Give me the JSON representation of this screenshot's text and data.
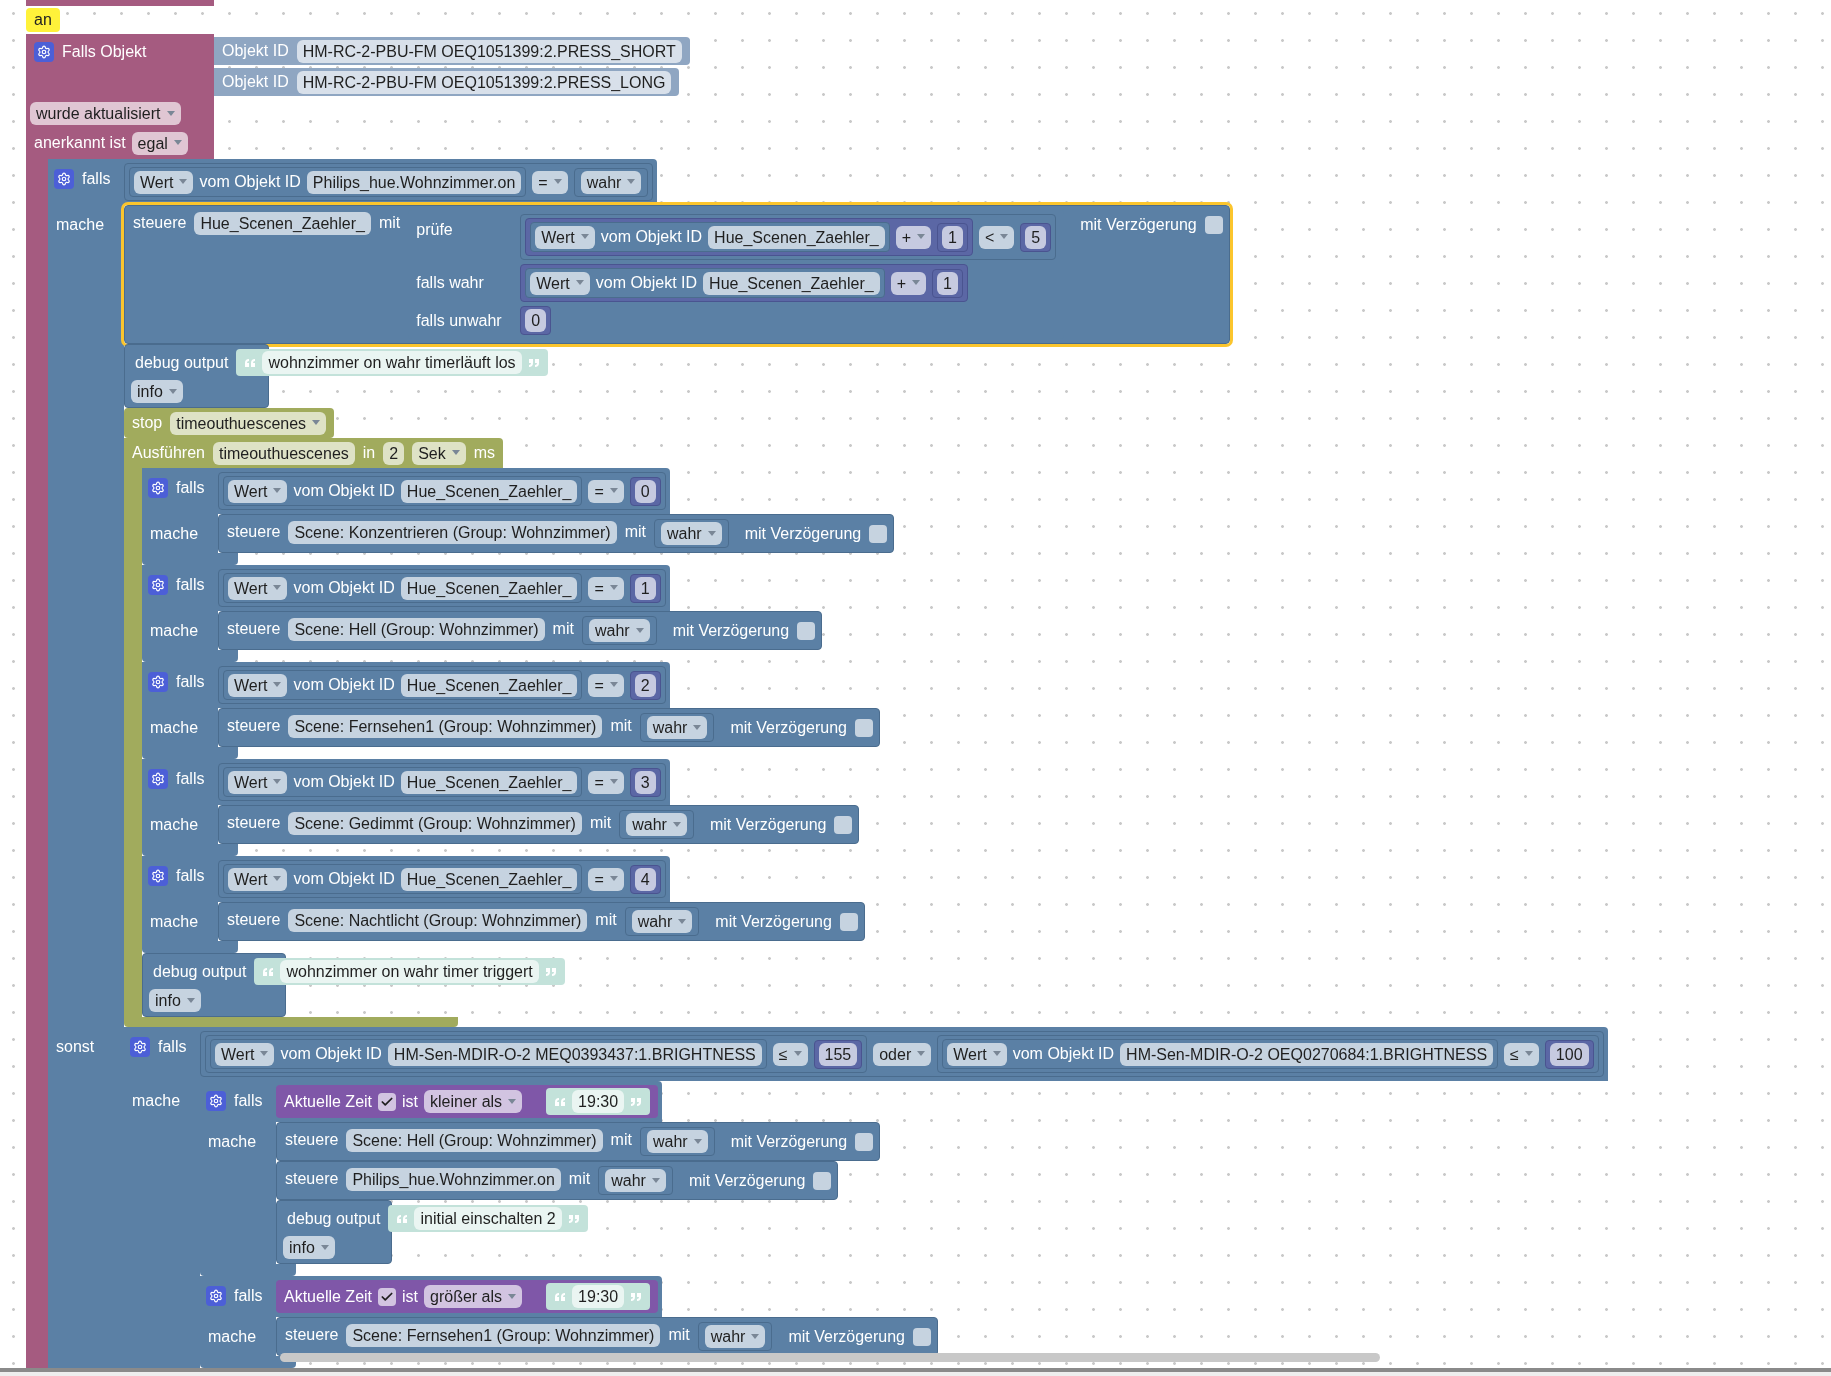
{
  "trigger": {
    "tag": "an",
    "title": "Falls Objekt",
    "objects": [
      {
        "label": "Objekt ID",
        "value": "HM-RC-2-PBU-FM OEQ1051399:2.PRESS_SHORT"
      },
      {
        "label": "Objekt ID",
        "value": "HM-RC-2-PBU-FM OEQ1051399:2.PRESS_LONG"
      }
    ],
    "event": "wurde aktualisiert",
    "ack_label": "anerkannt ist",
    "ack": "egal",
    "body": [
      {
        "kind": "if",
        "selected": false,
        "label": "falls",
        "condition": {
          "kind": "compare",
          "left": {
            "kind": "state",
            "attr": "Wert",
            "label": "vom Objekt ID",
            "id": "Philips_hue.Wohnzimmer.on"
          },
          "op": "=",
          "right": {
            "kind": "choice",
            "value": "wahr"
          }
        },
        "do_label": "mache",
        "do": [
          {
            "kind": "control",
            "selected": true,
            "label": "steuere",
            "target": "Hue_Scenen_Zaehler_",
            "with": "mit",
            "value": {
              "kind": "ternary",
              "test_label": "prüfe",
              "test": {
                "kind": "compare",
                "left": {
                  "kind": "arith",
                  "left": {
                    "kind": "state",
                    "attr": "Wert",
                    "label": "vom Objekt ID",
                    "id": "Hue_Scenen_Zaehler_"
                  },
                  "op": "+",
                  "right": {
                    "kind": "number",
                    "value": "1"
                  }
                },
                "op": "<",
                "right": {
                  "kind": "number",
                  "value": "5"
                }
              },
              "then_label": "falls wahr",
              "then": {
                "kind": "arith",
                "left": {
                  "kind": "state",
                  "attr": "Wert",
                  "label": "vom Objekt ID",
                  "id": "Hue_Scenen_Zaehler_"
                },
                "op": "+",
                "right": {
                  "kind": "number",
                  "value": "1"
                }
              },
              "else_label": "falls unwahr",
              "else": {
                "kind": "number",
                "value": "0"
              }
            },
            "delay_label": "mit Verzögerung",
            "delay": false
          },
          {
            "kind": "debug",
            "selected": false,
            "label": "debug output",
            "text": {
              "kind": "text",
              "value": "wohnzimmer on wahr timerläuft los"
            },
            "level": "info"
          },
          {
            "kind": "stop",
            "selected": false,
            "label": "stop",
            "timer": "timeouthuescenes"
          },
          {
            "kind": "timeout",
            "selected": false,
            "label": "Ausführen",
            "name": "timeouthuescenes",
            "in": "in",
            "value": "2",
            "unit": "Sek",
            "ms": "ms",
            "body": [
              {
                "kind": "if",
                "selected": false,
                "label": "falls",
                "condition": {
                  "kind": "compare",
                  "left": {
                    "kind": "state",
                    "attr": "Wert",
                    "label": "vom Objekt ID",
                    "id": "Hue_Scenen_Zaehler_"
                  },
                  "op": "=",
                  "right": {
                    "kind": "number",
                    "value": "0"
                  }
                },
                "do_label": "mache",
                "do": [
                  {
                    "kind": "control",
                    "selected": false,
                    "label": "steuere",
                    "target": "Scene: Konzentrieren (Group: Wohnzimmer)",
                    "with": "mit",
                    "value": {
                      "kind": "choice",
                      "value": "wahr"
                    },
                    "delay_label": "mit Verzögerung",
                    "delay": false
                  }
                ]
              },
              {
                "kind": "if",
                "selected": false,
                "label": "falls",
                "condition": {
                  "kind": "compare",
                  "left": {
                    "kind": "state",
                    "attr": "Wert",
                    "label": "vom Objekt ID",
                    "id": "Hue_Scenen_Zaehler_"
                  },
                  "op": "=",
                  "right": {
                    "kind": "number",
                    "value": "1"
                  }
                },
                "do_label": "mache",
                "do": [
                  {
                    "kind": "control",
                    "selected": false,
                    "label": "steuere",
                    "target": "Scene: Hell (Group: Wohnzimmer)",
                    "with": "mit",
                    "value": {
                      "kind": "choice",
                      "value": "wahr"
                    },
                    "delay_label": "mit Verzögerung",
                    "delay": false
                  }
                ]
              },
              {
                "kind": "if",
                "selected": false,
                "label": "falls",
                "condition": {
                  "kind": "compare",
                  "left": {
                    "kind": "state",
                    "attr": "Wert",
                    "label": "vom Objekt ID",
                    "id": "Hue_Scenen_Zaehler_"
                  },
                  "op": "=",
                  "right": {
                    "kind": "number",
                    "value": "2"
                  }
                },
                "do_label": "mache",
                "do": [
                  {
                    "kind": "control",
                    "selected": false,
                    "label": "steuere",
                    "target": "Scene: Fernsehen1 (Group: Wohnzimmer)",
                    "with": "mit",
                    "value": {
                      "kind": "choice",
                      "value": "wahr"
                    },
                    "delay_label": "mit Verzögerung",
                    "delay": false
                  }
                ]
              },
              {
                "kind": "if",
                "selected": false,
                "label": "falls",
                "condition": {
                  "kind": "compare",
                  "left": {
                    "kind": "state",
                    "attr": "Wert",
                    "label": "vom Objekt ID",
                    "id": "Hue_Scenen_Zaehler_"
                  },
                  "op": "=",
                  "right": {
                    "kind": "number",
                    "value": "3"
                  }
                },
                "do_label": "mache",
                "do": [
                  {
                    "kind": "control",
                    "selected": false,
                    "label": "steuere",
                    "target": "Scene: Gedimmt (Group: Wohnzimmer)",
                    "with": "mit",
                    "value": {
                      "kind": "choice",
                      "value": "wahr"
                    },
                    "delay_label": "mit Verzögerung",
                    "delay": false
                  }
                ]
              },
              {
                "kind": "if",
                "selected": false,
                "label": "falls",
                "condition": {
                  "kind": "compare",
                  "left": {
                    "kind": "state",
                    "attr": "Wert",
                    "label": "vom Objekt ID",
                    "id": "Hue_Scenen_Zaehler_"
                  },
                  "op": "=",
                  "right": {
                    "kind": "number",
                    "value": "4"
                  }
                },
                "do_label": "mache",
                "do": [
                  {
                    "kind": "control",
                    "selected": false,
                    "label": "steuere",
                    "target": "Scene: Nachtlicht (Group: Wohnzimmer)",
                    "with": "mit",
                    "value": {
                      "kind": "choice",
                      "value": "wahr"
                    },
                    "delay_label": "mit Verzögerung",
                    "delay": false
                  }
                ]
              },
              {
                "kind": "debug",
                "selected": false,
                "label": "debug output",
                "text": {
                  "kind": "text",
                  "value": "wohnzimmer on wahr timer triggert"
                },
                "level": "info"
              }
            ]
          }
        ],
        "else_label": "sonst",
        "else": [
          {
            "kind": "if",
            "selected": false,
            "label": "falls",
            "condition": {
              "kind": "logic",
              "left": {
                "kind": "compare",
                "left": {
                  "kind": "state",
                  "attr": "Wert",
                  "label": "vom Objekt ID",
                  "id": "HM-Sen-MDIR-O-2 MEQ0393437:1.BRIGHTNESS"
                },
                "op": "≤",
                "right": {
                  "kind": "number",
                  "value": "155"
                }
              },
              "op": "oder",
              "right": {
                "kind": "compare",
                "left": {
                  "kind": "state",
                  "attr": "Wert",
                  "label": "vom Objekt ID",
                  "id": "HM-Sen-MDIR-O-2 OEQ0270684:1.BRIGHTNESS"
                },
                "op": "≤",
                "right": {
                  "kind": "number",
                  "value": "100"
                }
              }
            },
            "do_label": "mache",
            "do": [
              {
                "kind": "if",
                "selected": false,
                "label": "falls",
                "condition": {
                  "kind": "time",
                  "label": "Aktuelle Zeit",
                  "checked": true,
                  "is": "ist",
                  "op": "kleiner als",
                  "value": {
                    "kind": "text",
                    "value": "19:30"
                  }
                },
                "do_label": "mache",
                "do": [
                  {
                    "kind": "control",
                    "selected": false,
                    "label": "steuere",
                    "target": "Scene: Hell (Group: Wohnzimmer)",
                    "with": "mit",
                    "value": {
                      "kind": "choice",
                      "value": "wahr"
                    },
                    "delay_label": "mit Verzögerung",
                    "delay": false
                  },
                  {
                    "kind": "control",
                    "selected": false,
                    "label": "steuere",
                    "target": "Philips_hue.Wohnzimmer.on",
                    "with": "mit",
                    "value": {
                      "kind": "choice",
                      "value": "wahr"
                    },
                    "delay_label": "mit Verzögerung",
                    "delay": false
                  },
                  {
                    "kind": "debug",
                    "selected": false,
                    "label": "debug output",
                    "text": {
                      "kind": "text",
                      "value": "initial einschalten 2"
                    },
                    "level": "info"
                  }
                ]
              },
              {
                "kind": "if",
                "selected": false,
                "label": "falls",
                "condition": {
                  "kind": "time",
                  "label": "Aktuelle Zeit",
                  "checked": true,
                  "is": "ist",
                  "op": "größer als",
                  "value": {
                    "kind": "text",
                    "value": "19:30"
                  }
                },
                "do_label": "mache",
                "do": [
                  {
                    "kind": "control",
                    "selected": false,
                    "label": "steuere",
                    "target": "Scene: Fernsehen1 (Group: Wohnzimmer)",
                    "with": "mit",
                    "value": {
                      "kind": "choice",
                      "value": "wahr"
                    },
                    "delay_label": "mit Verzögerung",
                    "delay": false
                  }
                ]
              }
            ]
          }
        ]
      }
    ]
  }
}
